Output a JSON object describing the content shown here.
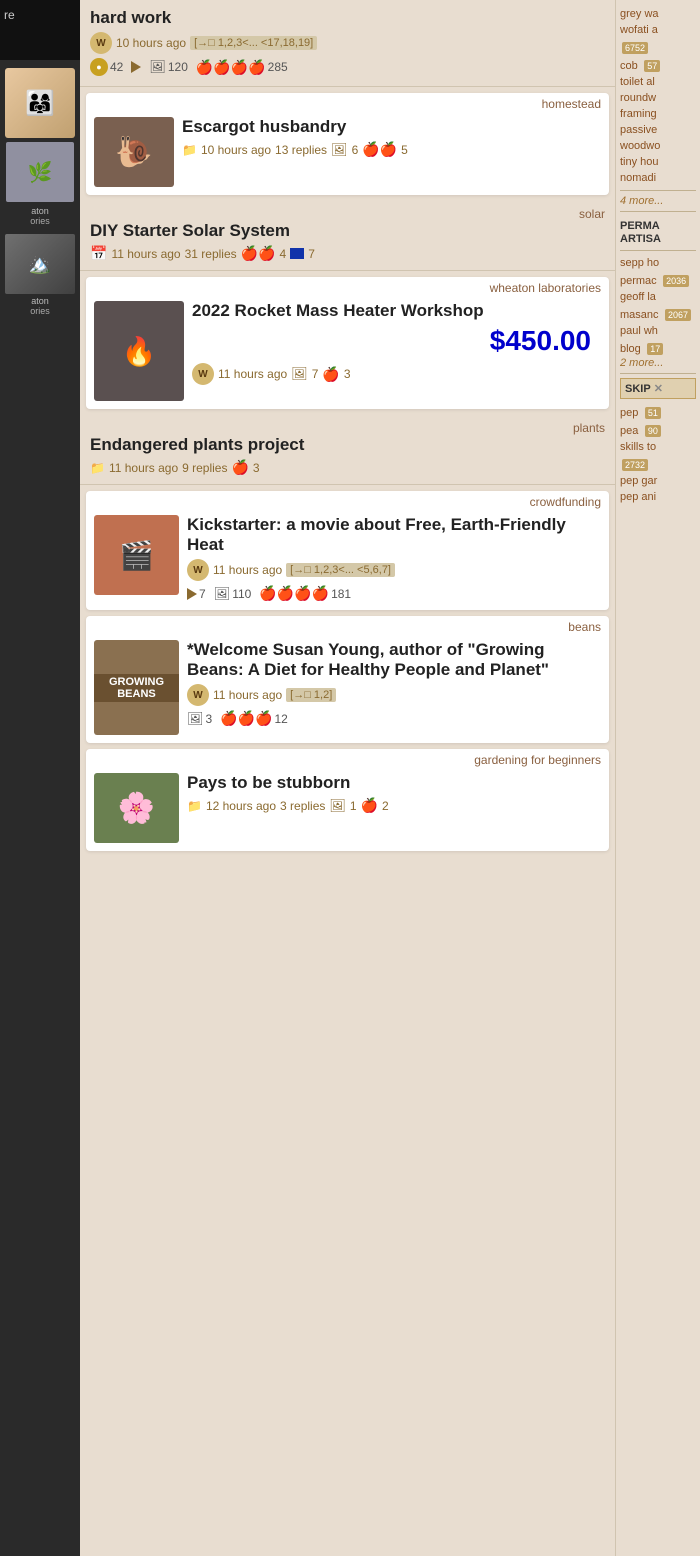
{
  "page": {
    "background": "#1a1a1a"
  },
  "top_post": {
    "title": "hard work",
    "time": "10 hours ago",
    "pages": "[→□ 1,2,3<... <17,18,19]",
    "gold_count": "42",
    "image_count": "120",
    "apples": "🍎🍎🍎🍎",
    "apple_count": "285"
  },
  "posts": [
    {
      "id": "escargot",
      "tag": "homestead",
      "title": "Escargot husbandry",
      "time": "10 hours ago",
      "replies": "13 replies",
      "image_count": "6",
      "apples": "🍎🍎",
      "apple_count": "5",
      "has_thumbnail": true,
      "thumb_color": "#7a6050",
      "thumb_emoji": "🐌"
    },
    {
      "id": "solar",
      "tag": "solar",
      "title": "DIY Starter Solar System",
      "time": "11 hours ago",
      "replies": "31 replies",
      "apples": "🍎🍎",
      "apple_count": "4",
      "flag_count": "7",
      "has_thumbnail": false
    },
    {
      "id": "rocket",
      "tag": "wheaton laboratories",
      "title": "2022 Rocket Mass Heater Workshop",
      "time": "11 hours ago",
      "price": "$450.00",
      "image_count": "7",
      "apples": "🍎",
      "apple_count": "3",
      "has_thumbnail": true,
      "thumb_color": "#5a5050",
      "thumb_emoji": "🔥"
    },
    {
      "id": "plants",
      "tag": "plants",
      "title": "Endangered plants project",
      "time": "11 hours ago",
      "replies": "9 replies",
      "apples": "🍎",
      "apple_count": "3",
      "has_thumbnail": false
    },
    {
      "id": "kickstarter",
      "tag": "crowdfunding",
      "title": "Kickstarter: a movie about Free, Earth-Friendly Heat",
      "time": "11 hours ago",
      "pages": "[→□ 1,2,3<... <5,6,7]",
      "play_count": "7",
      "image_count": "110",
      "apples": "🍎🍎🍎🍎",
      "apple_count": "181",
      "has_thumbnail": true,
      "thumb_color": "#c07050",
      "thumb_emoji": "🎬"
    },
    {
      "id": "beans",
      "tag": "beans",
      "title": "*Welcome Susan Young, author of \"Growing Beans: A Diet for Healthy People and Planet\"",
      "time": "11 hours ago",
      "pages": "[→□ 1,2]",
      "image_count": "3",
      "apples": "🍎🍎🍎",
      "apple_count": "12",
      "has_thumbnail": true,
      "thumb_color": "#8a7050",
      "thumb_emoji": "🫘"
    },
    {
      "id": "stubborn",
      "tag": "gardening for beginners",
      "title": "Pays to be stubborn",
      "time": "12 hours ago",
      "replies": "3 replies",
      "image_count": "1",
      "apples": "🍎",
      "apple_count": "2",
      "has_thumbnail": true,
      "thumb_color": "#6a8050",
      "thumb_emoji": "🌸"
    }
  ],
  "right_sidebar": {
    "links": [
      {
        "text": "grey wa",
        "badge": null
      },
      {
        "text": "wofati a",
        "badge": "6752"
      },
      {
        "text": "cob",
        "badge": "57"
      },
      {
        "text": "toilet al",
        "badge": null
      },
      {
        "text": "roundw",
        "badge": null
      },
      {
        "text": "framing",
        "badge": null
      },
      {
        "text": "passive",
        "badge": null
      },
      {
        "text": "woodwo",
        "badge": null
      },
      {
        "text": "tiny hou",
        "badge": null
      },
      {
        "text": "nomadi",
        "badge": null
      }
    ],
    "more_text": "4 more...",
    "section_title": "PERMA\nARTISA",
    "section_links": [
      {
        "text": "sepp ho",
        "badge": null
      },
      {
        "text": "permac",
        "badge": "2036"
      },
      {
        "text": "geoff la",
        "badge": null
      },
      {
        "text": "masanc",
        "badge": "2067"
      },
      {
        "text": "paul wh",
        "badge": null
      },
      {
        "text": "blog",
        "badge": "17"
      }
    ],
    "more2_text": "2 more...",
    "skip_label": "SKIP",
    "skip_links": [
      {
        "text": "pep",
        "badge": "51"
      },
      {
        "text": "pea",
        "badge": "90"
      },
      {
        "text": "skills to",
        "badge": null
      },
      {
        "text": "",
        "badge": "2732"
      },
      {
        "text": "pep gar",
        "badge": null
      },
      {
        "text": "pep ani",
        "badge": null
      }
    ]
  },
  "left_sidebar": {
    "top_text": "re",
    "bottom_labels": [
      "aton",
      "ories",
      "aton",
      "ories"
    ]
  }
}
